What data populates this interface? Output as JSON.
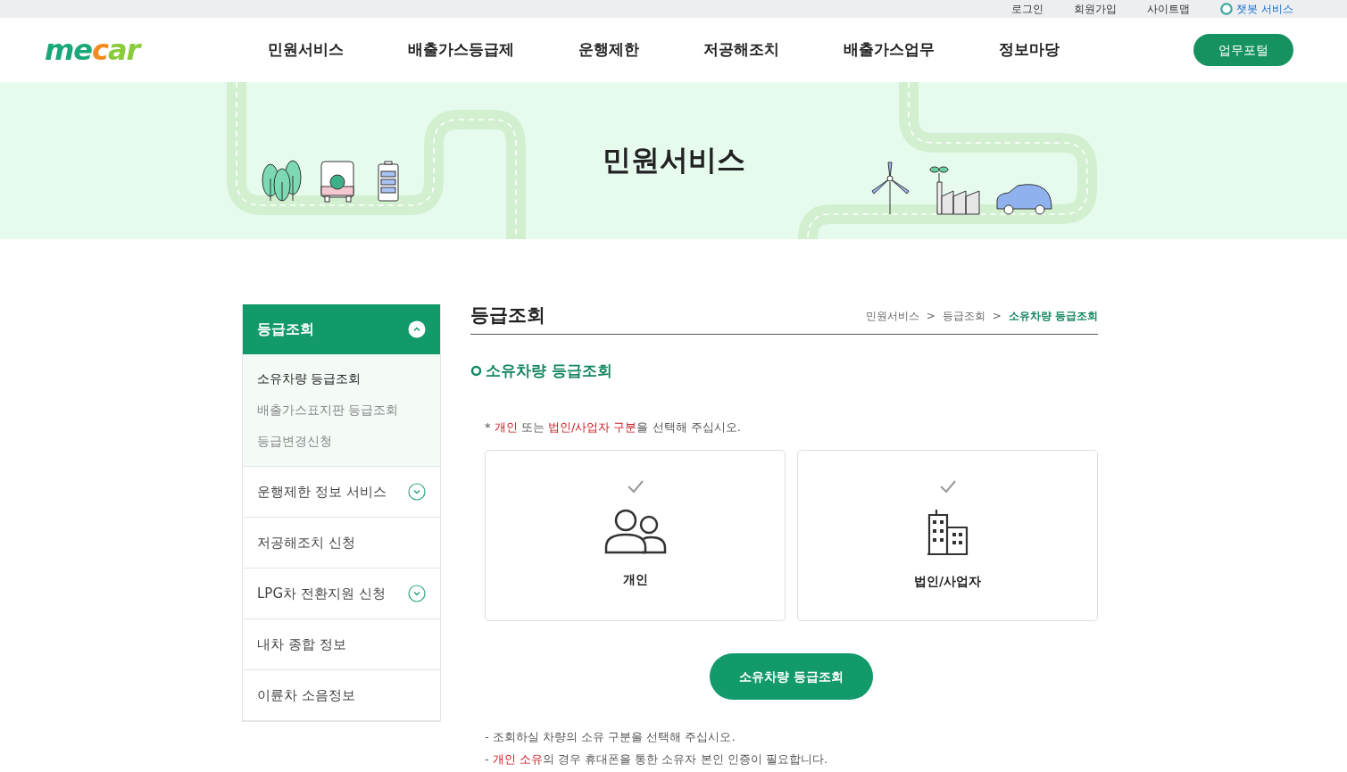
{
  "utility_links": [
    {
      "label": "로그인",
      "kind": "link"
    },
    {
      "label": "회원가입",
      "kind": "link"
    },
    {
      "label": "사이트맵",
      "kind": "link"
    },
    {
      "label": "챗봇 서비스",
      "kind": "chatbot"
    }
  ],
  "header": {
    "logo": "mecar",
    "nav": [
      "민원서비스",
      "배출가스등급제",
      "운행제한",
      "저공해조치",
      "배출가스업무",
      "정보마당"
    ],
    "portal_button": "업무포털"
  },
  "banner": {
    "title": "민원서비스"
  },
  "sidebar": {
    "items": [
      {
        "label": "등급조회",
        "expandable": true,
        "expanded": true,
        "children": [
          {
            "label": "소유차량 등급조회",
            "selected": true
          },
          {
            "label": "배출가스표지판 등급조회",
            "selected": false
          },
          {
            "label": "등급변경신청",
            "selected": false
          }
        ]
      },
      {
        "label": "운행제한 정보 서비스",
        "expandable": true,
        "expanded": false
      },
      {
        "label": "저공해조치 신청",
        "expandable": false,
        "expanded": false
      },
      {
        "label": "LPG차 전환지원 신청",
        "expandable": true,
        "expanded": false
      },
      {
        "label": "내차 종합 정보",
        "expandable": false,
        "expanded": false
      },
      {
        "label": "이륜차 소음정보",
        "expandable": false,
        "expanded": false
      }
    ]
  },
  "page": {
    "title": "등급조회",
    "breadcrumb": [
      {
        "label": "민원서비스",
        "selected": false
      },
      {
        "label": "등급조회",
        "selected": false
      },
      {
        "label": "소유차량 등급조회",
        "selected": true
      }
    ],
    "separator": ">",
    "section_title": "소유차량 등급조회",
    "instruction": [
      {
        "text": "* ",
        "kind": "plain"
      },
      {
        "text": "개인",
        "kind": "highlight"
      },
      {
        "text": " 또는 ",
        "kind": "plain"
      },
      {
        "text": "법인/사업자 구분",
        "kind": "highlight"
      },
      {
        "text": "을 선택해 주십시오.",
        "kind": "plain"
      }
    ],
    "options": [
      {
        "label": "개인",
        "kind": "person",
        "selected": false
      },
      {
        "label": "법인/사업자",
        "kind": "building",
        "selected": false
      }
    ],
    "submit_button": "소유차량 등급조회",
    "notes": [
      [
        {
          "text": "- 조회하실 차량의 소유 구분을 선택해 주십시오.",
          "kind": "plain"
        }
      ],
      [
        {
          "text": "- ",
          "kind": "plain"
        },
        {
          "text": "개인 소유",
          "kind": "highlight"
        },
        {
          "text": "의 경우 휴대폰을 통한 소유자 본인 인증이 필요합니다.",
          "kind": "plain"
        }
      ]
    ]
  }
}
